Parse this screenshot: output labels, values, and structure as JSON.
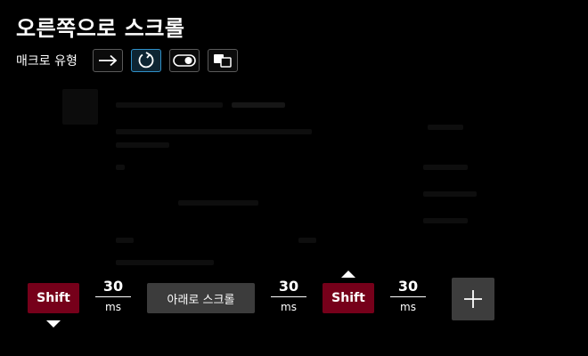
{
  "title": "오른쪽으로 스크롤",
  "macro_type": {
    "label": "매크로 유형",
    "options": [
      {
        "id": "arrow-right-icon",
        "selected": false
      },
      {
        "id": "loop-icon",
        "selected": true
      },
      {
        "id": "toggle-icon",
        "selected": false
      },
      {
        "id": "sequence-icon",
        "selected": false
      }
    ]
  },
  "sequence": {
    "key_1": "Shift",
    "delay_1": {
      "value": "30",
      "unit": "ms"
    },
    "action": "아래로 스크롤",
    "delay_2": {
      "value": "30",
      "unit": "ms"
    },
    "key_2": "Shift",
    "delay_3": {
      "value": "30",
      "unit": "ms"
    }
  },
  "colors": {
    "key_chip": "#76001a",
    "action_chip": "#3c3c3c",
    "selected_accent": "#2f90c8"
  }
}
